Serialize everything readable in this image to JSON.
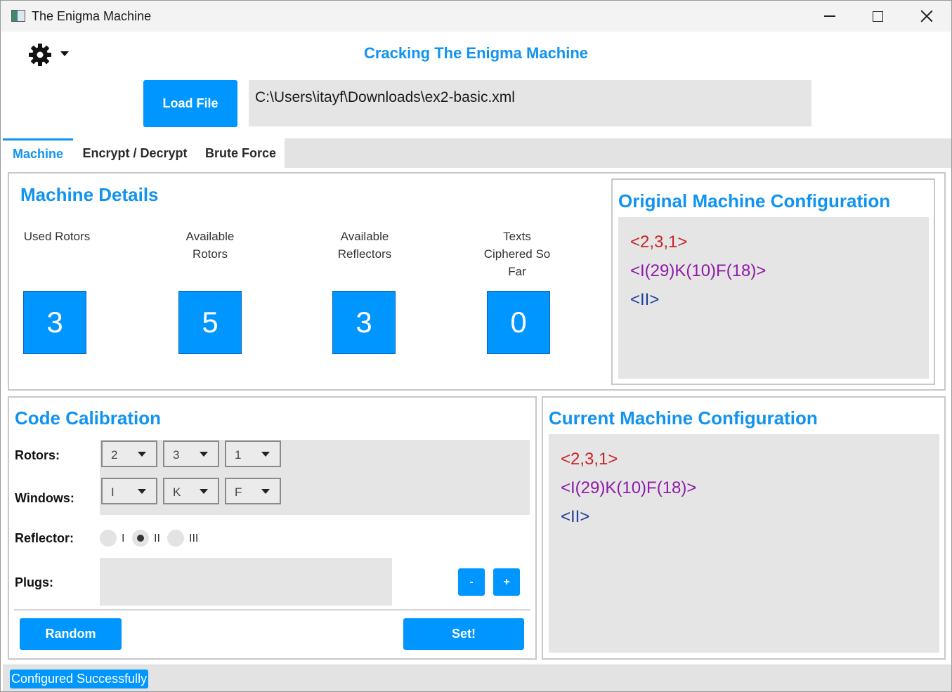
{
  "window": {
    "title": "The Enigma Machine"
  },
  "header": {
    "settings_icon": "gear-icon",
    "heading": "Cracking The Enigma Machine",
    "load_button": "Load File",
    "file_path": "C:\\Users\\itayf\\Downloads\\ex2-basic.xml"
  },
  "tabs": [
    {
      "label": "Machine",
      "selected": true
    },
    {
      "label": "Encrypt / Decrypt",
      "selected": false
    },
    {
      "label": "Brute Force",
      "selected": false
    }
  ],
  "machine_details": {
    "title": "Machine Details",
    "stats": [
      {
        "label": "Used Rotors",
        "value": "3"
      },
      {
        "label": "Available Rotors",
        "value": "5"
      },
      {
        "label": "Available Reflectors",
        "value": "3"
      },
      {
        "label": "Texts Ciphered So Far",
        "value": "0"
      }
    ]
  },
  "original_config": {
    "title": "Original Machine Configuration",
    "lines": [
      "<2,3,1>",
      "<I(29)K(10)F(18)>",
      "<II>"
    ]
  },
  "code_calibration": {
    "title": "Code Calibration",
    "rotors_label": "Rotors:",
    "rotors": [
      "2",
      "3",
      "1"
    ],
    "windows_label": "Windows:",
    "windows": [
      "I",
      "K",
      "F"
    ],
    "reflector_label": "Reflector:",
    "reflector_options": [
      {
        "label": "I",
        "selected": false
      },
      {
        "label": "II",
        "selected": true
      },
      {
        "label": "III",
        "selected": false
      }
    ],
    "plugs_label": "Plugs:",
    "minus_button": "-",
    "plus_button": "+",
    "random_button": "Random",
    "set_button": "Set!"
  },
  "current_config": {
    "title": "Current Machine Configuration",
    "lines": [
      "<2,3,1>",
      "<I(29)K(10)F(18)>",
      "<II>"
    ]
  },
  "status": {
    "message": "Configured Successfully"
  },
  "colors": {
    "accent": "#0096ff",
    "title_blue": "#1193f0",
    "config_red": "#c8232a",
    "config_purple": "#8e1aa8",
    "config_blue": "#1f3f9a"
  }
}
